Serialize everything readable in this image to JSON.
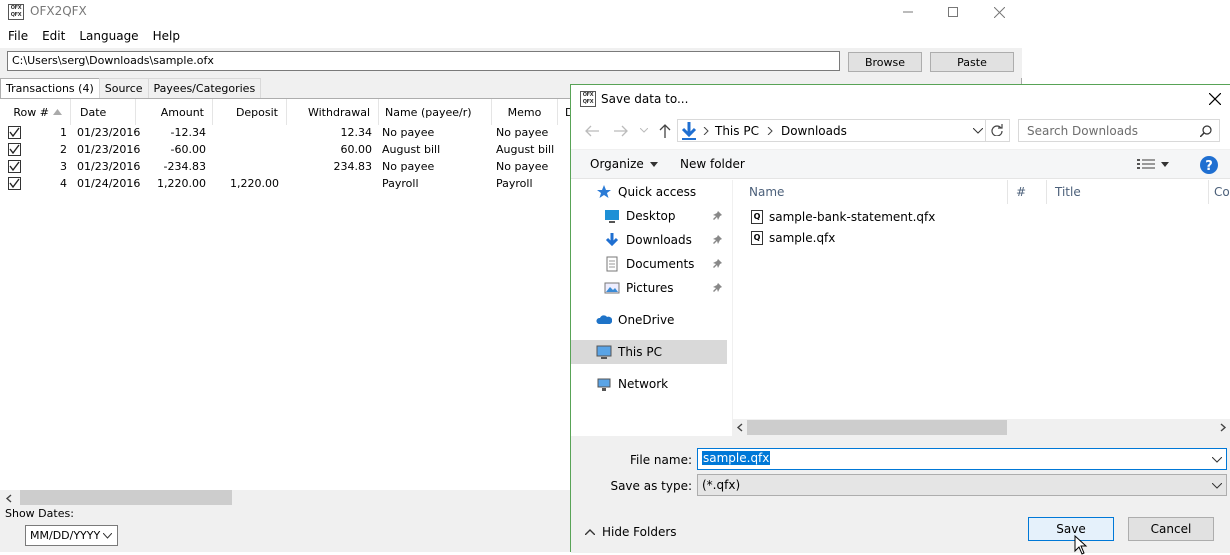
{
  "app": {
    "title": "OFX2QFX",
    "icon_text": "OFX QFX",
    "menu": [
      "File",
      "Edit",
      "Language",
      "Help"
    ],
    "path_value": "C:\\Users\\serg\\Downloads\\sample.ofx",
    "browse_label": "Browse",
    "paste_label": "Paste",
    "tabs": [
      "Transactions (4)",
      "Source",
      "Payees/Categories"
    ],
    "columns": [
      "Row #",
      "Date",
      "Amount",
      "Deposit",
      "Withdrawal",
      "Name (payee/r)",
      "Memo",
      "D"
    ],
    "rows": [
      {
        "checked": true,
        "row": "1",
        "date": "01/23/2016",
        "amount": "-12.34",
        "deposit": "",
        "withdrawal": "12.34",
        "name": "No payee",
        "memo": "No payee"
      },
      {
        "checked": true,
        "row": "2",
        "date": "01/23/2016",
        "amount": "-60.00",
        "deposit": "",
        "withdrawal": "60.00",
        "name": "August bill",
        "memo": "August bill"
      },
      {
        "checked": true,
        "row": "3",
        "date": "01/23/2016",
        "amount": "-234.83",
        "deposit": "",
        "withdrawal": "234.83",
        "name": "No payee",
        "memo": "No payee"
      },
      {
        "checked": true,
        "row": "4",
        "date": "01/24/2016",
        "amount": "1,220.00",
        "deposit": "1,220.00",
        "withdrawal": "",
        "name": "Payroll",
        "memo": "Payroll"
      }
    ],
    "show_dates_label": "Show Dates:",
    "date_format": "MM/DD/YYYY"
  },
  "dialog": {
    "title": "Save data to...",
    "breadcrumb": [
      "This PC",
      "Downloads"
    ],
    "search_placeholder": "Search Downloads",
    "organize_label": "Organize",
    "new_folder_label": "New folder",
    "nav_items": [
      {
        "label": "Quick access",
        "icon": "star-icon"
      },
      {
        "label": "Desktop",
        "icon": "desktop-icon",
        "pinned": true
      },
      {
        "label": "Downloads",
        "icon": "downloads-icon",
        "pinned": true
      },
      {
        "label": "Documents",
        "icon": "documents-icon",
        "pinned": true
      },
      {
        "label": "Pictures",
        "icon": "pictures-icon",
        "pinned": true
      },
      {
        "label": "OneDrive",
        "icon": "cloud-icon"
      },
      {
        "label": "This PC",
        "icon": "computer-icon",
        "selected": true
      },
      {
        "label": "Network",
        "icon": "network-icon"
      }
    ],
    "file_columns": [
      "Name",
      "#",
      "Title",
      "Co"
    ],
    "files": [
      "sample-bank-statement.qfx",
      "sample.qfx"
    ],
    "file_name_label": "File name:",
    "file_name_value": "sample.qfx",
    "save_type_label": "Save as type:",
    "save_type_value": "(*.qfx)",
    "hide_folders_label": "Hide Folders",
    "save_label": "Save",
    "cancel_label": "Cancel"
  },
  "colors": {
    "accent": "#0078d7",
    "selection": "#d9d9d9",
    "dialog_border": "#58a356"
  }
}
